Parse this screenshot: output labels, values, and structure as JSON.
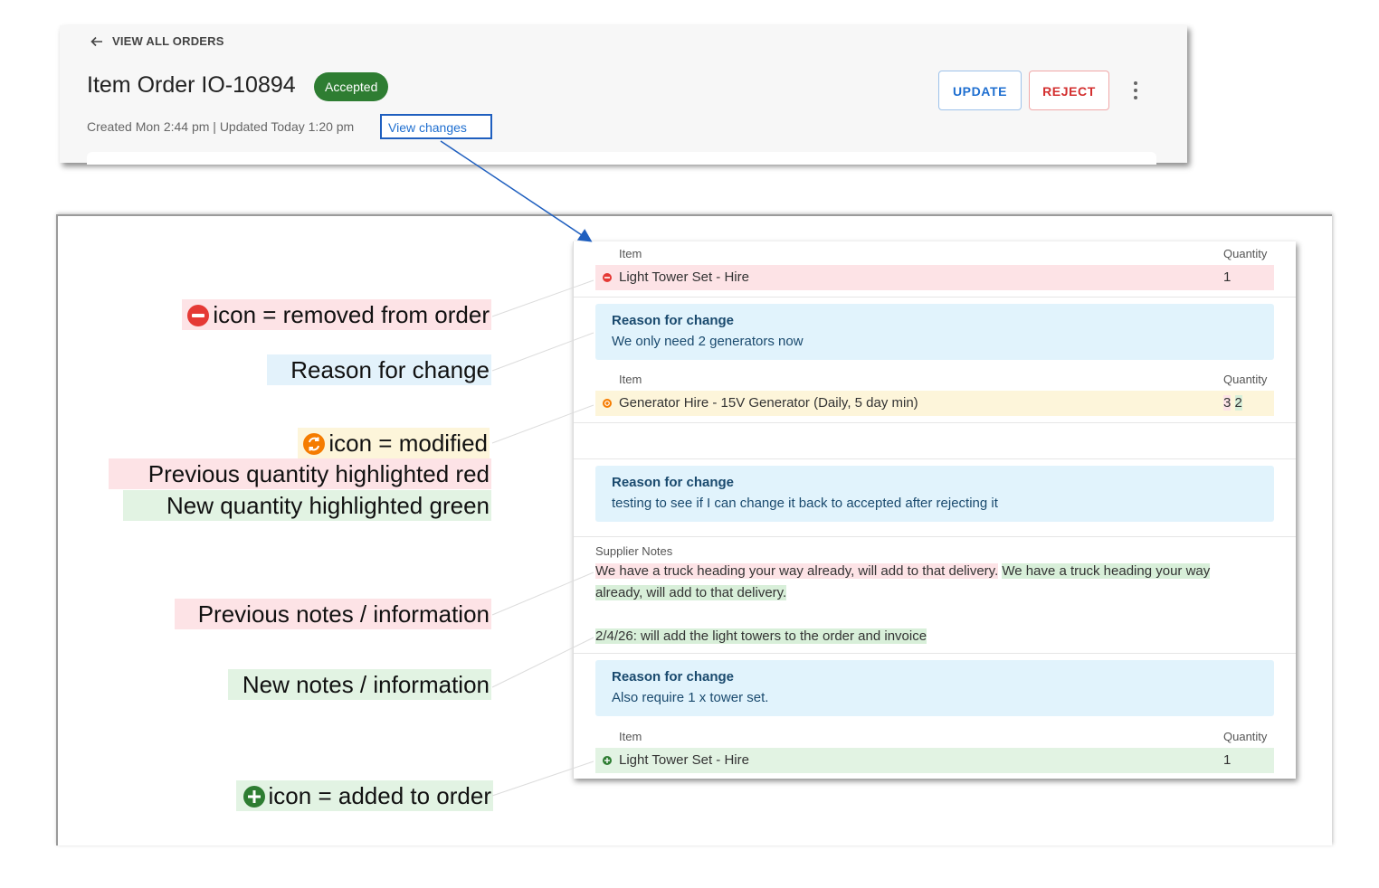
{
  "order_header": {
    "back_label": "VIEW ALL ORDERS",
    "title": "Item Order IO-10894",
    "status": "Accepted",
    "meta": "Created Mon 2:44 pm | Updated Today 1:20 pm",
    "view_changes_label": "View changes",
    "update_label": "UPDATE",
    "reject_label": "REJECT"
  },
  "legend": {
    "removed": "icon = removed from order",
    "reason": "Reason for change",
    "modified": "icon = modified",
    "prev_qty": "Previous quantity highlighted red",
    "new_qty": "New quantity highlighted green",
    "prev_notes": "Previous notes / information",
    "new_notes": "New notes / information",
    "added": "icon = added to order"
  },
  "changes": {
    "item_header": "Item",
    "quantity_header": "Quantity",
    "removed_item": {
      "name": "Light Tower Set - Hire",
      "quantity": "1"
    },
    "reason_1": {
      "title": "Reason for change",
      "text": "We only need 2 generators now"
    },
    "modified_item": {
      "name": "Generator Hire - 15V Generator (Daily, 5 day min)",
      "old_quantity": "3",
      "new_quantity": "2"
    },
    "reason_2": {
      "title": "Reason for change",
      "text": "testing to see if I can change it back to accepted after rejecting it"
    },
    "supplier_notes_label": "Supplier Notes",
    "old_note": "We have a truck heading your way already, will add to that delivery.",
    "new_note_part1": "We have a truck heading your way",
    "new_note_part2": "already, will add to that delivery.",
    "new_note_line2": "2/4/26: will add the light towers to the order and invoice",
    "reason_3": {
      "title": "Reason for change",
      "text": "Also require 1 x tower set."
    },
    "added_item": {
      "name": "Light Tower Set - Hire",
      "quantity": "1"
    }
  },
  "colors": {
    "removed": "#e53935",
    "modified": "#f57c00",
    "added": "#2e7d32",
    "accent": "#1f6fd0"
  }
}
